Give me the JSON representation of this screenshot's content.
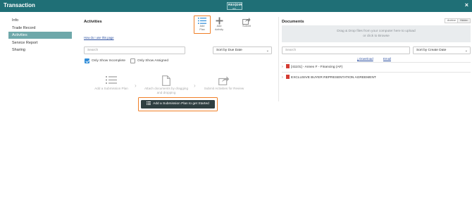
{
  "window": {
    "title": "Transaction",
    "logo_line1": "REX|DIR",
    "logo_line2": "app",
    "close_glyph": "×"
  },
  "sidebar": {
    "items": [
      {
        "label": "Info",
        "active": false
      },
      {
        "label": "Trade Record",
        "active": false
      },
      {
        "label": "Activities",
        "active": true
      },
      {
        "label": "Service Report",
        "active": false
      },
      {
        "label": "Sharing",
        "active": false
      }
    ]
  },
  "activities": {
    "title": "Activities",
    "how_link": "How do I use this page",
    "toolbar": {
      "add_plan_line1": "Add",
      "add_plan_line2": "Plan",
      "add_activity_line1": "Add",
      "add_activity_line2": "Activity",
      "submit": "Submit"
    },
    "search_placeholder": "Search",
    "sort_select": "Sort by Due Date",
    "only_incomplete": {
      "label": "Only Show Incomplete",
      "checked": true
    },
    "only_assigned": {
      "label": "Only Show Assigned",
      "checked": false
    },
    "steps": [
      {
        "icon": "list-plan-icon",
        "text": "Add a Submission Plan"
      },
      {
        "icon": "document-icon",
        "text_line1": "Attach documents by dragging",
        "text_line2": "and dropping"
      },
      {
        "icon": "share-submit-icon",
        "text": "Submit Activities for Review"
      }
    ],
    "cta_button": "Add a Submission Plan to get Started"
  },
  "documents": {
    "title": "Documents",
    "toggle_active": "Archive",
    "toggle_other": "Hidden",
    "dropzone_line1": "Drag & Drop files from your computer here to upload",
    "dropzone_line2": "or click to Browse",
    "search_placeholder": "Search",
    "sort_select": "Sort by Create Date",
    "download": "Download",
    "email": "Email",
    "rows": [
      {
        "label": "[41101] - Annex F - Financing (AF)"
      },
      {
        "label": "EXCLUSIVE BUYER REPRESENTATION AGREEMENT"
      }
    ]
  },
  "colors": {
    "titlebar": "#1f6f76",
    "sidebar_active": "#6ea8aa",
    "highlight": "#f07f27",
    "cta": "#2f3f41"
  }
}
